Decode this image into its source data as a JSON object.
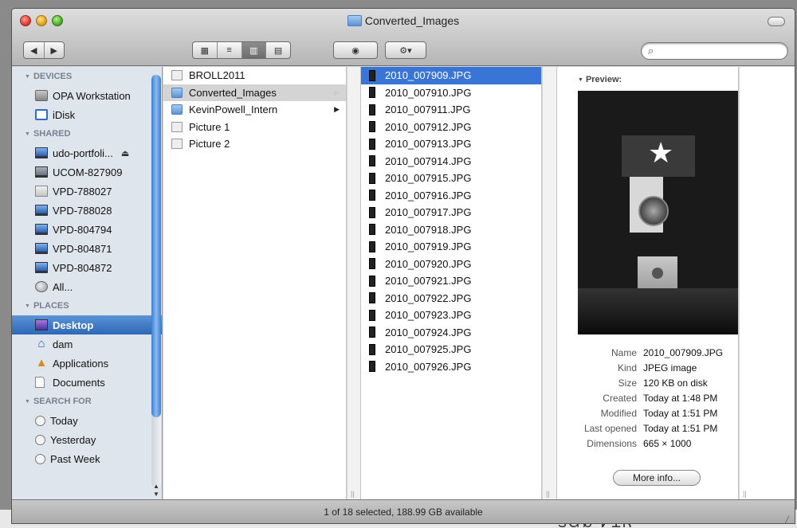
{
  "window": {
    "title": "Converted_Images"
  },
  "toolbar": {
    "nav": [
      "◀",
      "▶"
    ],
    "views": [
      "▦",
      "≡",
      "▥",
      "▤"
    ],
    "quicklook": "◉",
    "action": "⚙▾",
    "search_placeholder": "",
    "search_icon": "search-icon"
  },
  "sidebar": {
    "sections": [
      {
        "title": "DEVICES",
        "items": [
          {
            "label": "OPA Workstation",
            "icon": "drive-icon"
          },
          {
            "label": "iDisk",
            "icon": "idisk-icon"
          }
        ]
      },
      {
        "title": "SHARED",
        "items": [
          {
            "label": "udo-portfoli...",
            "icon": "monitor-icon",
            "eject": "⏏"
          },
          {
            "label": "UCOM-827909",
            "icon": "monitor-icon"
          },
          {
            "label": "VPD-788027",
            "icon": "server-icon"
          },
          {
            "label": "VPD-788028",
            "icon": "monitor-icon"
          },
          {
            "label": "VPD-804794",
            "icon": "monitor-icon"
          },
          {
            "label": "VPD-804871",
            "icon": "monitor-icon"
          },
          {
            "label": "VPD-804872",
            "icon": "monitor-icon"
          },
          {
            "label": "All...",
            "icon": "globe-icon"
          }
        ]
      },
      {
        "title": "PLACES",
        "items": [
          {
            "label": "Desktop",
            "icon": "desktop-icon",
            "selected": true
          },
          {
            "label": "dam",
            "icon": "home-icon"
          },
          {
            "label": "Applications",
            "icon": "applications-icon"
          },
          {
            "label": "Documents",
            "icon": "document-icon"
          }
        ]
      },
      {
        "title": "SEARCH FOR",
        "items": [
          {
            "label": "Today",
            "icon": "clock-icon"
          },
          {
            "label": "Yesterday",
            "icon": "clock-icon"
          },
          {
            "label": "Past Week",
            "icon": "clock-icon"
          }
        ]
      }
    ]
  },
  "column1": [
    {
      "label": "BROLL2011",
      "type": "image"
    },
    {
      "label": "Converted_Images",
      "type": "folder",
      "highlighted": true,
      "arrow": "▶"
    },
    {
      "label": "KevinPowell_Intern",
      "type": "folder",
      "arrow": "▶"
    },
    {
      "label": "Picture 1",
      "type": "image"
    },
    {
      "label": "Picture 2",
      "type": "image"
    }
  ],
  "column2": [
    "2010_007909.JPG",
    "2010_007910.JPG",
    "2010_007911.JPG",
    "2010_007912.JPG",
    "2010_007913.JPG",
    "2010_007914.JPG",
    "2010_007915.JPG",
    "2010_007916.JPG",
    "2010_007917.JPG",
    "2010_007918.JPG",
    "2010_007919.JPG",
    "2010_007920.JPG",
    "2010_007921.JPG",
    "2010_007922.JPG",
    "2010_007923.JPG",
    "2010_007924.JPG",
    "2010_007925.JPG",
    "2010_007926.JPG"
  ],
  "selected_index": 0,
  "preview": {
    "label": "Preview:",
    "info": [
      {
        "key": "Name",
        "value": "2010_007909.JPG"
      },
      {
        "key": "Kind",
        "value": "JPEG image"
      },
      {
        "key": "Size",
        "value": "120 KB on disk"
      },
      {
        "key": "Created",
        "value": "Today at 1:48 PM"
      },
      {
        "key": "Modified",
        "value": "Today at 1:51 PM"
      },
      {
        "key": "Last opened",
        "value": "Today at 1:51 PM"
      },
      {
        "key": "Dimensions",
        "value": "665 × 1000"
      }
    ],
    "more_button": "More info..."
  },
  "status": {
    "text": "1 of 18 selected, 188.99 GB available"
  },
  "background_text": "ᏕᏳᏰ ᏤᏆᏒ"
}
